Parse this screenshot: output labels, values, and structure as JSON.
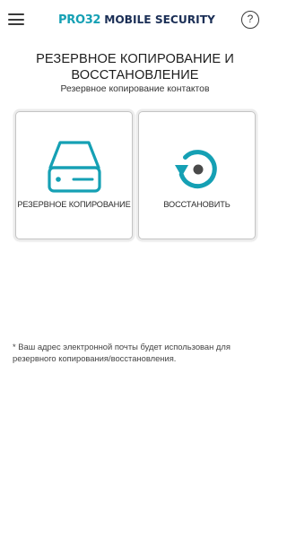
{
  "header": {
    "brand": "PRO32",
    "product": "MOBILE SECURITY",
    "help_label": "?",
    "menu_icon": "hamburger-menu-icon",
    "brand_color": "#15a0b4",
    "product_color": "#1b2f56"
  },
  "page": {
    "title": "РЕЗЕРВНОЕ КОПИРОВАНИЕ И ВОССТАНОВЛЕНИЕ",
    "subtitle": "Резервное копирование контактов"
  },
  "actions": {
    "backup": {
      "label": "РЕЗЕРВНОЕ КОПИРОВАНИЕ",
      "icon": "hard-drive-icon"
    },
    "restore": {
      "label": "ВОССТАНОВИТЬ",
      "icon": "restore-icon"
    },
    "accent_color": "#15a0b4"
  },
  "footnote": "* Ваш адрес электронной почты будет использован для резервного копирования/восстановления."
}
